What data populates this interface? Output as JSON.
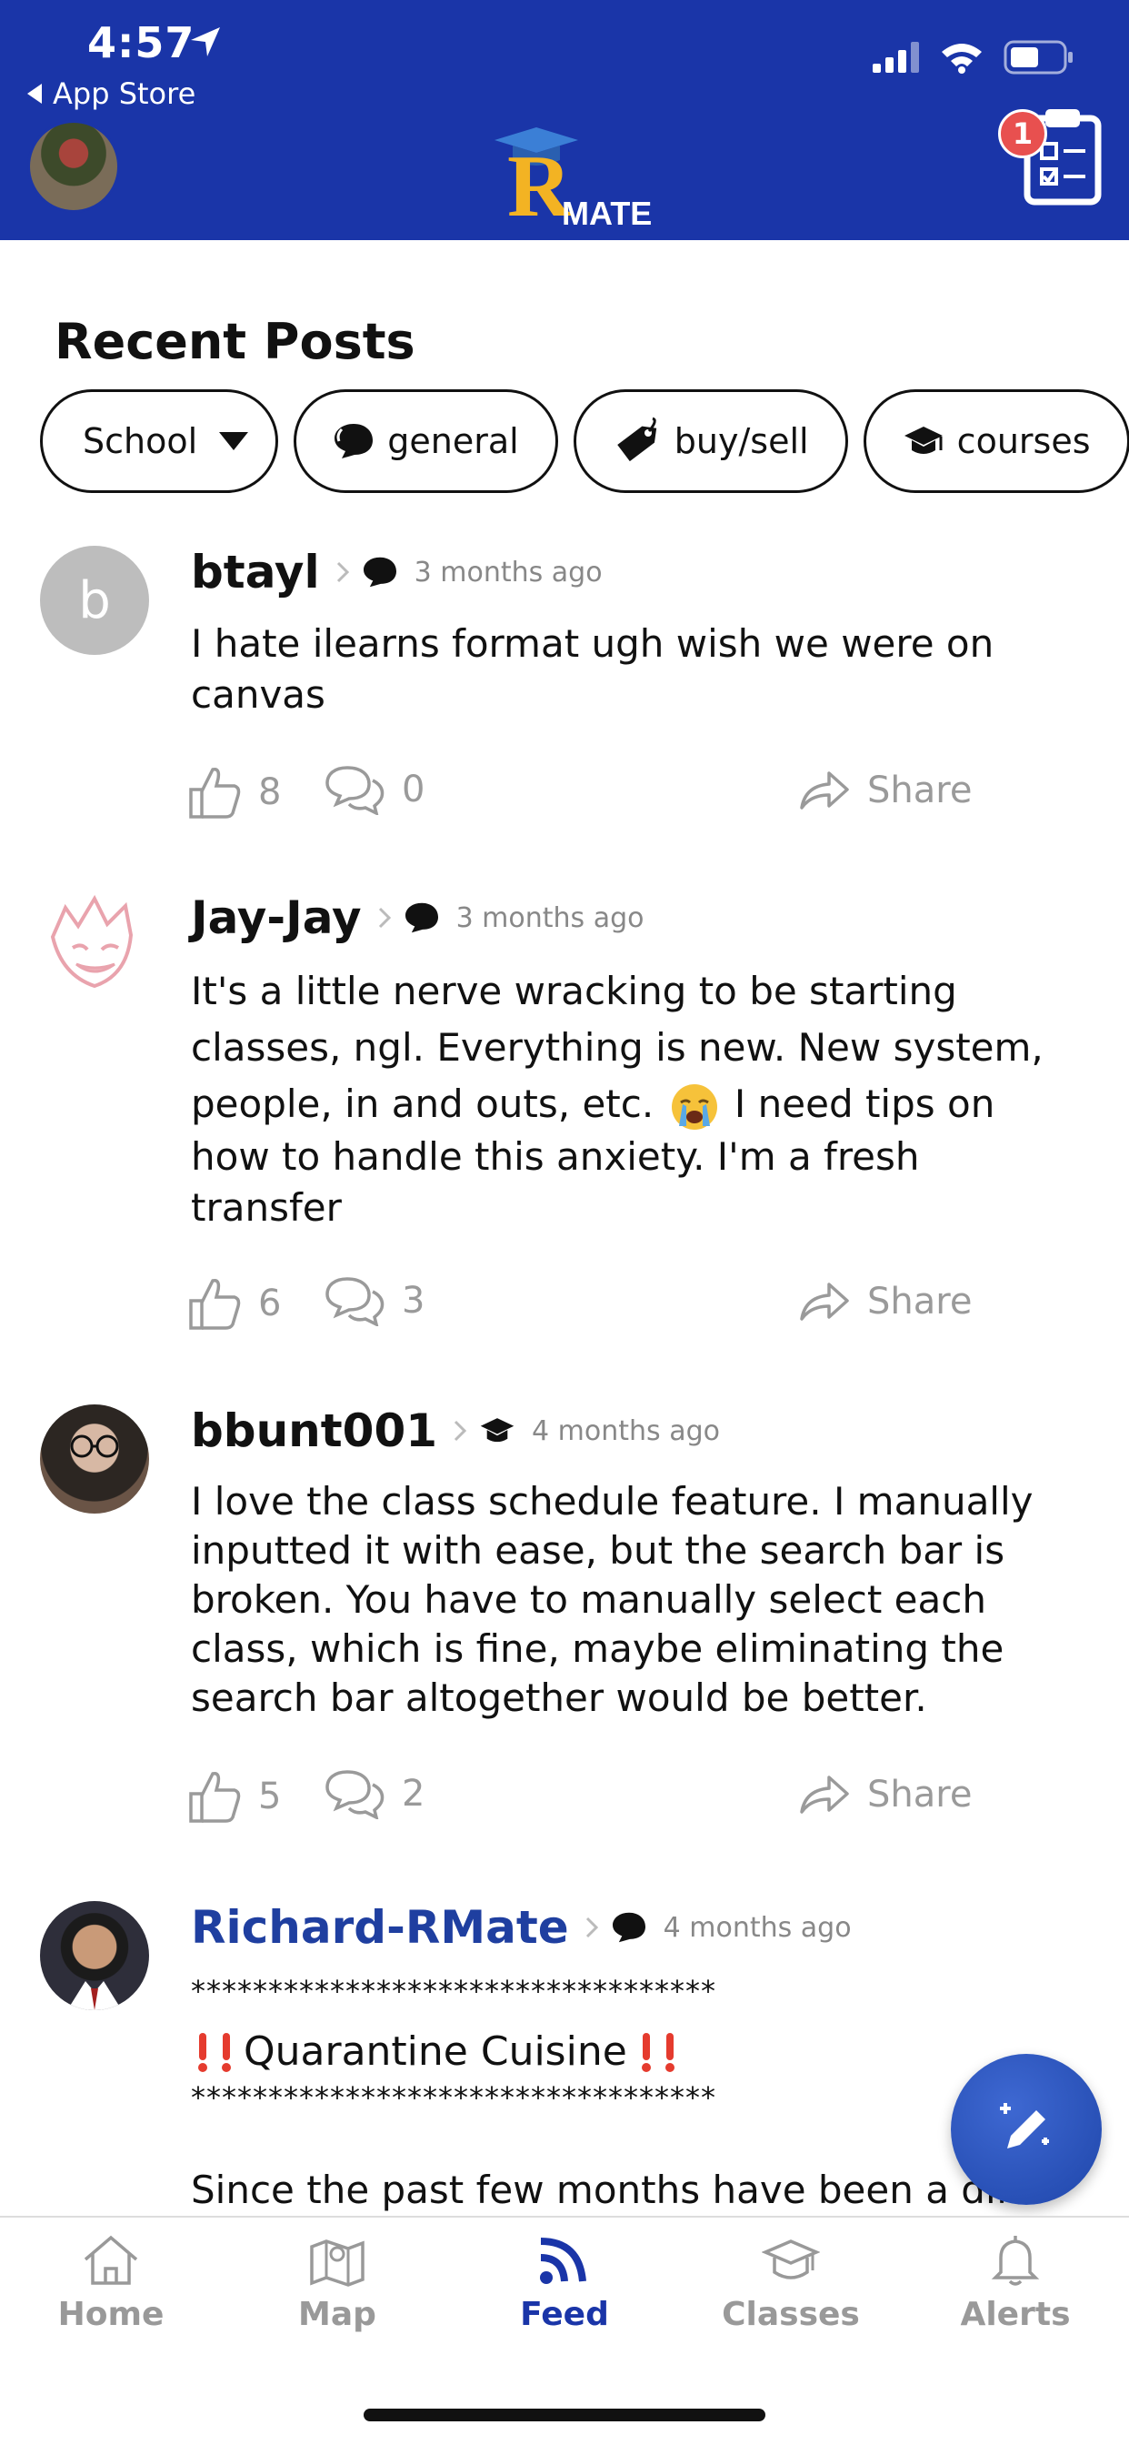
{
  "status_bar": {
    "time": "4:57",
    "back_label": "App Store"
  },
  "header": {
    "logo_letter": "R",
    "logo_word": "MATE",
    "badge_count": "1"
  },
  "section_title": "Recent Posts",
  "filters": [
    {
      "label": "School",
      "icon": "chevron-down-icon"
    },
    {
      "label": "general",
      "icon": "chat-bubble-icon"
    },
    {
      "label": "buy/sell",
      "icon": "tag-icon"
    },
    {
      "label": "courses",
      "icon": "graduation-cap-icon"
    }
  ],
  "posts": [
    {
      "author": "btayl",
      "avatar_letter": "b",
      "category_icon": "chat-bubble-icon",
      "time": "3 months ago",
      "lines": [
        "I hate ilearns format ugh wish we were on",
        "canvas"
      ],
      "likes": "8",
      "comments": "0",
      "share": "Share"
    },
    {
      "author": "Jay-Jay",
      "category_icon": "chat-bubble-icon",
      "time": "3 months ago",
      "lines": [
        "It's a little nerve wracking to be starting",
        "classes, ngl. Everything is new. New system,",
        "people, in and outs, etc.",
        " I need tips on",
        "how to handle this anxiety. I'm a fresh",
        "transfer"
      ],
      "likes": "6",
      "comments": "3",
      "share": "Share"
    },
    {
      "author": "bbunt001",
      "category_icon": "graduation-cap-icon",
      "time": "4 months ago",
      "lines": [
        "I love the class schedule feature. I manually",
        "inputted it with ease, but the search bar is",
        "broken. You have to manually select each",
        "class, which is fine, maybe eliminating the",
        "search bar altogether would be better."
      ],
      "likes": "5",
      "comments": "2",
      "share": "Share"
    },
    {
      "author": "Richard-RMate",
      "category_icon": "chat-bubble-icon",
      "time": "4 months ago",
      "lines": [
        "**********************************",
        "Quarantine Cuisine",
        "**********************************",
        "Since the past few months have been a dif"
      ]
    }
  ],
  "tabs": [
    {
      "label": "Home",
      "icon": "home-icon"
    },
    {
      "label": "Map",
      "icon": "map-icon"
    },
    {
      "label": "Feed",
      "icon": "feed-icon"
    },
    {
      "label": "Classes",
      "icon": "classes-icon"
    },
    {
      "label": "Alerts",
      "icon": "bell-icon"
    }
  ],
  "colors": {
    "header_bg": "#1a35a8",
    "accent": "#1a35a8",
    "badge": "#e8504f",
    "muted": "#999999",
    "logo_gold": "#f3b323"
  }
}
